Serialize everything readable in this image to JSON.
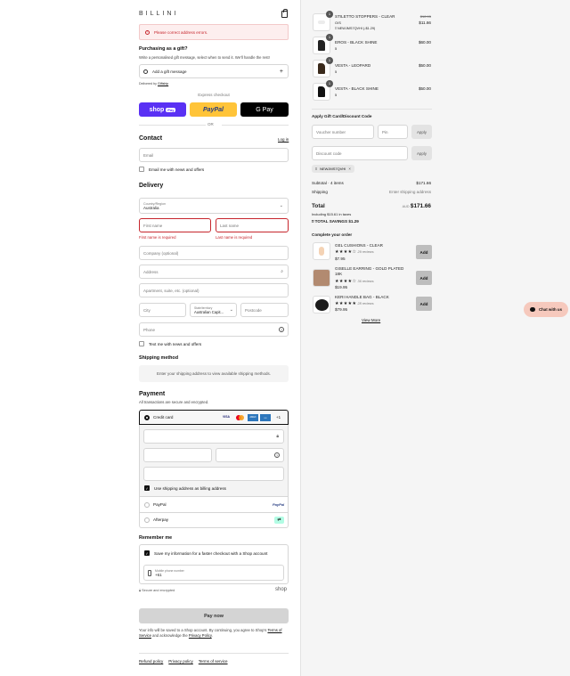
{
  "header": {
    "brand": "BILLINI"
  },
  "error_banner": "Please correct address errors.",
  "gift": {
    "title": "Purchasing as a gift?",
    "subtitle": "Write a personalised gift message, select when to send it. We'll handle the rest!",
    "add_label": "Add a gift message",
    "plus": "+",
    "delivered_by_prefix": "Delivered by",
    "delivered_by_link": "Giftship"
  },
  "express": {
    "label": "Express checkout",
    "shop_label": "shop",
    "shop_pay": "Pay",
    "paypal_label": "PayPal",
    "gpay_label": "G Pay",
    "or": "OR"
  },
  "contact": {
    "title": "Contact",
    "login": "Log in",
    "email_placeholder": "Email",
    "news_label": "Email me with news and offers"
  },
  "delivery": {
    "title": "Delivery",
    "country_label": "Country/Region",
    "country_value": "Australia",
    "first_name": "First name",
    "last_name": "Last name",
    "first_error": "First name is required",
    "last_error": "Last name is required",
    "company": "Company (optional)",
    "address": "Address",
    "apartment": "Apartment, suite, etc. (optional)",
    "city": "City",
    "state_label": "State/territory",
    "state_value": "Australian Capit...",
    "postcode": "Postcode",
    "phone": "Phone",
    "text_label": "Text me with news and offers"
  },
  "shipping": {
    "title": "Shipping method",
    "message": "Enter your shipping address to view available shipping methods."
  },
  "payment": {
    "title": "Payment",
    "subtitle": "All transactions are secure and encrypted.",
    "credit_card": "Credit card",
    "card_badges": [
      "VISA",
      "MC",
      "AMEX",
      "•••"
    ],
    "more_cards": "+1",
    "billing_label": "Use shipping address as billing address",
    "paypal": "PayPal",
    "paypal_logo": "PayPal",
    "afterpay": "Afterpay"
  },
  "remember": {
    "title": "Remember me",
    "save_label": "Save my information for a faster checkout with a Shop account",
    "mobile_label": "Mobile phone number",
    "mobile_value": "+61",
    "secure": "Secure and encrypted",
    "shop": "shop"
  },
  "pay_now": "Pay now",
  "legal": {
    "text_1": "Your info will be saved to a Shop account. By continuing, you agree to Shop's",
    "terms": "Terms of Service",
    "text_2": "and acknowledge the",
    "privacy": "Privacy Policy",
    "end": "."
  },
  "footer": [
    "Refund policy",
    "Privacy policy",
    "Terms of service"
  ],
  "cart": {
    "items": [
      {
        "name": "STILETTO STOPPERS - CLEAR",
        "variant": "O/S",
        "discount": "NEWJMS7QVHI (-$1.29)",
        "old_price": "$12.95",
        "price": "$11.66",
        "qty": "1"
      },
      {
        "name": "EROS - BLACK SHINE",
        "variant": "5",
        "price": "$60.00",
        "qty": "1"
      },
      {
        "name": "VESTA - LEOPARD",
        "variant": "5",
        "price": "$50.00",
        "qty": "1"
      },
      {
        "name": "VESTA - BLACK SHINE",
        "variant": "5",
        "price": "$50.00",
        "qty": "1"
      }
    ],
    "gift_title": "Apply Gift Card/Discount Code",
    "voucher_placeholder": "Voucher number",
    "pin_placeholder": "Pin",
    "apply": "Apply",
    "discount_placeholder": "Discount code",
    "code_tag": "NEWJMS7QVHI",
    "subtotal_label": "Subtotal · 4 items",
    "subtotal_value": "$171.66",
    "shipping_label": "Shipping",
    "shipping_value": "Enter shipping address",
    "total_label": "Total",
    "currency": "AUD",
    "total_value": "$171.66",
    "taxes": "Including $15.61 in taxes",
    "savings_label": "TOTAL SAVINGS",
    "savings_value": "$1.29",
    "complete_title": "Complete your order",
    "upsell": [
      {
        "name": "GEL CUSHIONS - CLEAR",
        "rating": 4.5,
        "stars": "★★★★☆",
        "reviews": "29 reviews",
        "price": "$7.95"
      },
      {
        "name": "GISELLE EARRING - GOLD PLATED 18K",
        "rating": 4.5,
        "stars": "★★★★☆",
        "reviews": "36 reviews",
        "price": "$19.95"
      },
      {
        "name": "KERI HANDLE BAG - BLACK",
        "rating": 5,
        "stars": "★★★★★",
        "reviews": "28 reviews",
        "price": "$79.95"
      }
    ],
    "add": "Add",
    "view_more": "View More"
  },
  "chat": {
    "label": "Chat with us"
  },
  "colors": {
    "error": "#c6252c",
    "shop_pay": "#5a31f4",
    "paypal": "#ffc439",
    "chat_bg": "#f6c9bd"
  }
}
